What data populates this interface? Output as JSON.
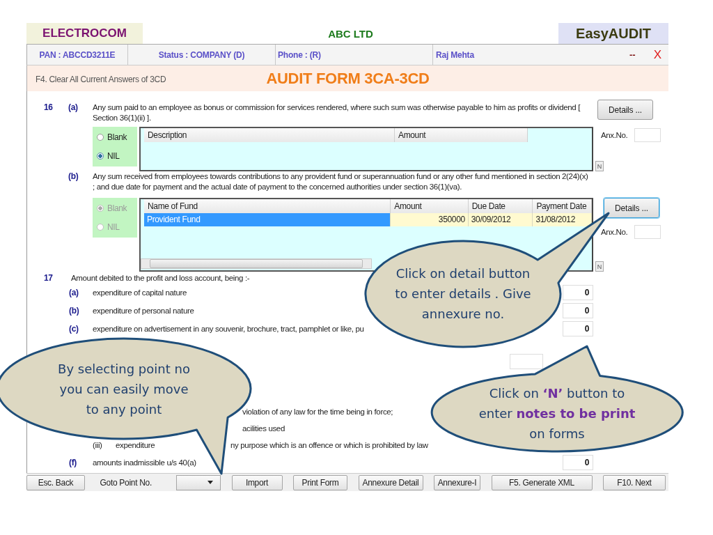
{
  "header": {
    "brand": "ELECTROCOM",
    "company": "ABC LTD",
    "product": "EasyAUDIT"
  },
  "info_bar": {
    "pan": "PAN : ABCCD3211E",
    "status": "Status : COMPANY (D)",
    "phone": "Phone : (R)",
    "user": "Raj Mehta",
    "minimize": "--",
    "close": "X"
  },
  "form_bar": {
    "shortcut": "F4. Clear All Current Answers of 3CD",
    "title": "AUDIT FORM 3CA-3CD"
  },
  "question_16": {
    "number": "16",
    "parts": [
      {
        "label": "(a)",
        "text": "Any sum paid to an employee as bonus or commission for services rendered, where such sum was otherwise payable to him as profits or dividend [ Section 36(1)(ii) ].",
        "details_button": "Details ...",
        "details_focused": false,
        "options_disabled": false,
        "options": [
          {
            "label": "Blank",
            "selected": false
          },
          {
            "label": "NIL",
            "selected": true
          }
        ],
        "table": {
          "columns": [
            "Description",
            "Amount"
          ],
          "horizontal_scrollbar": false
        },
        "anx_label": "Anx.No.",
        "notes_button": "N"
      },
      {
        "label": "(b)",
        "text": "Any sum received from employees towards contributions to any provident fund or superannuation fund or any other fund mentioned in section 2(24)(x) ; and due date for payment and the actual date of payment to the concerned authorities under section 36(1)(va).",
        "details_button": "Details ...",
        "details_focused": true,
        "options_disabled": true,
        "options": [
          {
            "label": "Blank",
            "selected": true
          },
          {
            "label": "NIL",
            "selected": false
          }
        ],
        "table": {
          "columns": [
            "Name of Fund",
            "Amount",
            "Due Date",
            "Payment Date"
          ],
          "horizontal_scrollbar": true,
          "rows": [
            {
              "selected": true,
              "cells": [
                "Provident Fund",
                "350000",
                "30/09/2012",
                "31/08/2012"
              ]
            }
          ]
        },
        "anx_label": "Anx.No.",
        "notes_button": "N"
      }
    ]
  },
  "question_17": {
    "number": "17",
    "text": "Amount debited to the profit and loss account, being :-",
    "rows": [
      {
        "kind": "item",
        "label": "(a)",
        "text": "expenditure of capital nature",
        "value": "0"
      },
      {
        "kind": "item",
        "label": "(b)",
        "text": "expenditure of personal nature",
        "value": "0"
      },
      {
        "kind": "item",
        "label": "(c)",
        "text": "expenditure on advertisement in any souvenir, brochure, tract, pamphlet or like, pu",
        "value": "0"
      },
      {
        "kind": "field"
      },
      {
        "kind": "partial",
        "parts": [
          "violation of any law for the time being in force;"
        ]
      },
      {
        "kind": "partial",
        "parts": [
          "acilities used"
        ]
      },
      {
        "kind": "partial",
        "roman": "(iii)",
        "parts": [
          "expenditure",
          "ny purpose which is an offence or which is prohibited by law"
        ]
      },
      {
        "kind": "item",
        "label": "(f)",
        "text": "amounts inadmissible u/s 40(a)",
        "value": "0"
      }
    ]
  },
  "toolbar": [
    {
      "kind": "button",
      "label": "Esc. Back"
    },
    {
      "kind": "label",
      "label": "Goto Point No."
    },
    {
      "kind": "dropdown"
    },
    {
      "kind": "button",
      "label": "Import"
    },
    {
      "kind": "button",
      "label": "Print Form"
    },
    {
      "kind": "button",
      "label": "Annexure Detail"
    },
    {
      "kind": "button",
      "label": "Annexure-I"
    },
    {
      "kind": "button",
      "label": "F5. Generate XML"
    },
    {
      "kind": "button",
      "label": "F10. Next"
    }
  ],
  "callouts": [
    {
      "text": "Click on detail button\nto enter details . Give\nannexure no."
    },
    {
      "text": "By selecting point no\nyou can easily move\nto any point"
    },
    {
      "text": "Click on **‘N’** button to\nenter **notes to be print**\non forms"
    }
  ]
}
